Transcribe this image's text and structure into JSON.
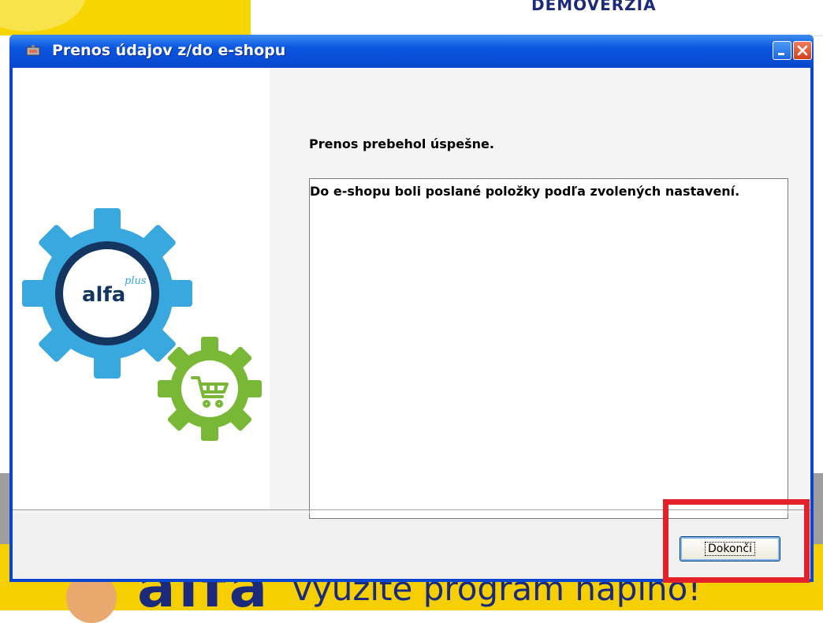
{
  "window": {
    "title": "Prenos údajov z/do e-shopu",
    "minimize_label": "_",
    "close_label": "×"
  },
  "logo": {
    "brand": "alfa",
    "brand_sup": "plus"
  },
  "content": {
    "status_title": "Prenos prebehol úspešne.",
    "message": "Do e-shopu boli poslané položky podľa zvolených nastavení."
  },
  "buttons": {
    "finish_label": "Dokonči"
  },
  "background": {
    "heading": "DEMOVERZIA",
    "banner_brand": "alfa",
    "banner_slogan": "využite program naplno!"
  },
  "colors": {
    "titlebar": "#0a55e0",
    "gear_blue": "#38a8df",
    "gear_ring": "#14355f",
    "gear_green": "#79b837",
    "highlight_red": "#e3212b",
    "banner_yellow": "#f6cf00"
  }
}
